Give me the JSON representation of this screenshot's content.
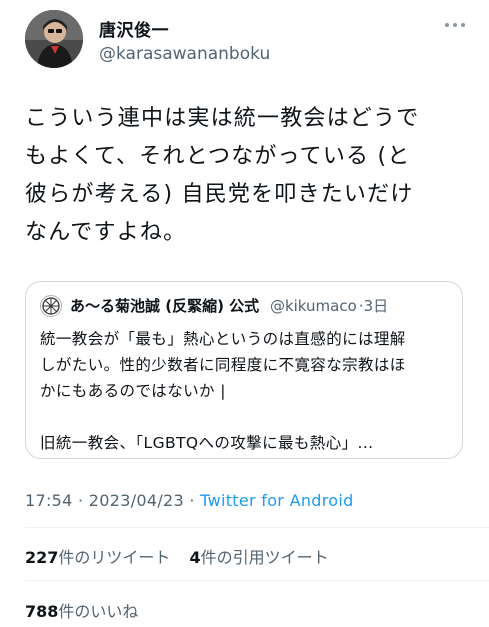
{
  "author": {
    "name": "唐沢俊一",
    "handle": "@karasawananboku"
  },
  "tweet": {
    "lines": [
      "こういう連中は実は統一教会はどうで",
      "もよくて、それとつながっている (と",
      "彼らが考える) 自民党を叩きたいだけ",
      "なんですよね。"
    ]
  },
  "quote": {
    "name": "あ～る菊池誠 (反緊縮) 公式",
    "handle": "@kikumaco",
    "sep": "·",
    "time": "3日",
    "lines": [
      "統一教会が「最も」熱心というのは直感的には理解",
      "しがたい。性的少数者に同程度に不寛容な宗教はほ",
      "かにもあるのではないか |",
      "",
      "旧統一教会、「LGBTQへの攻撃に最も熱心」..."
    ]
  },
  "meta": {
    "time": "17:54",
    "sep1": "·",
    "date": "2023/04/23",
    "sep2": "·",
    "source": "Twitter for Android"
  },
  "stats": {
    "retweets": "227",
    "retweets_label": "件のリツイート",
    "quotes": "4",
    "quotes_label": "件の引用ツイート",
    "likes": "788",
    "likes_label": "件のいいね"
  },
  "colors": {
    "text": "#0f1419",
    "muted": "#536471",
    "link": "#1d9bf0",
    "border": "#cfd9de"
  }
}
